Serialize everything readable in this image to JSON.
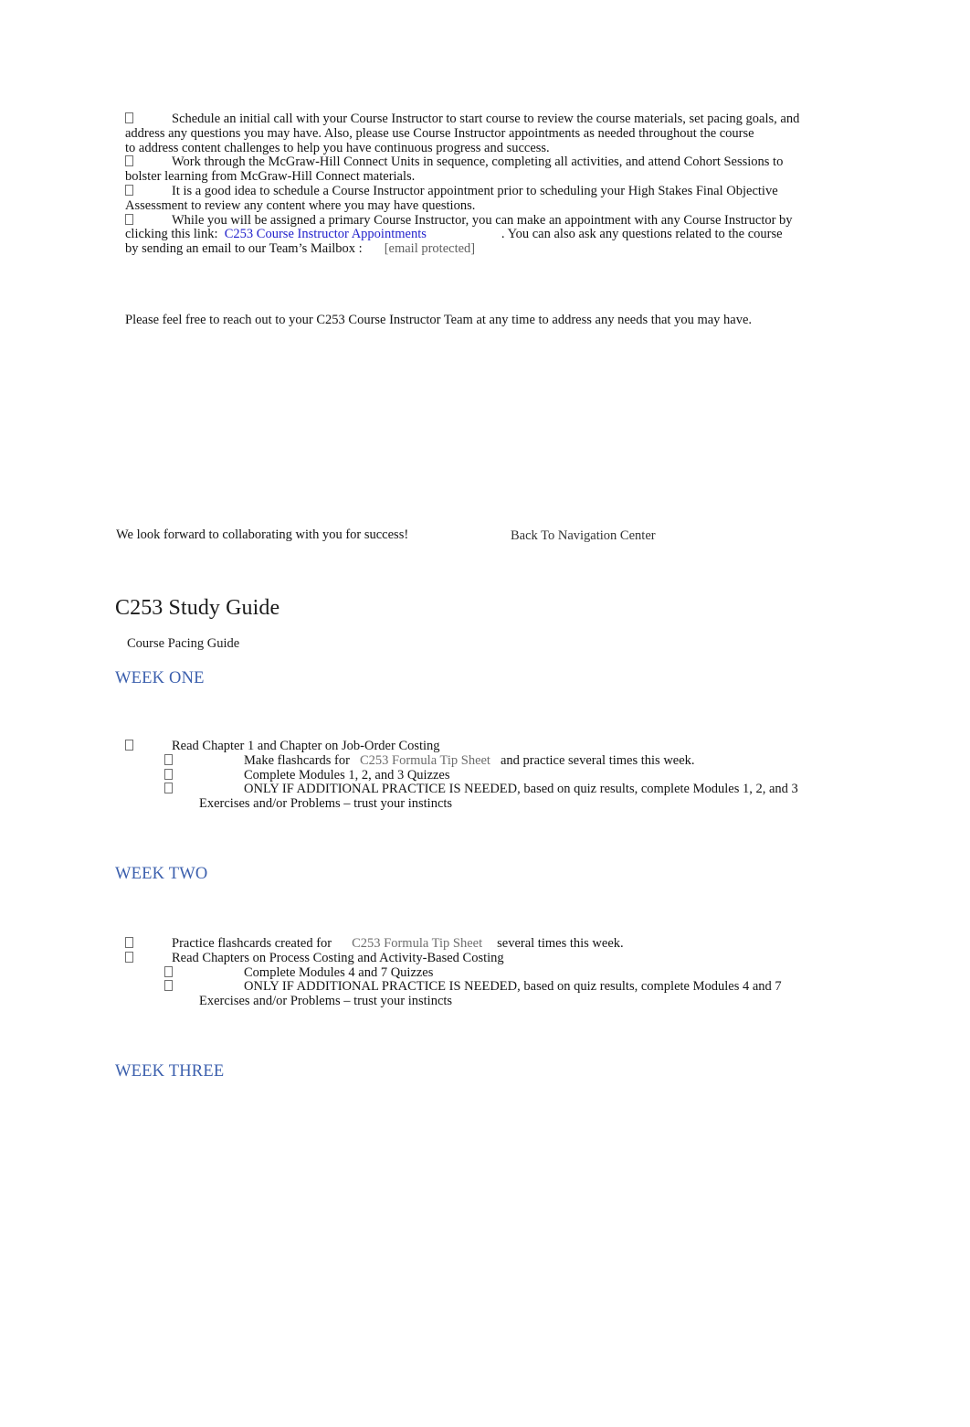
{
  "document": {
    "title": "C253 Study Guide"
  },
  "intro_bullets": [
    {
      "id": "bullet-initial-call",
      "lines": [
        "Schedule an initial call with your Course Instructor to start course to review the course materials, set pacing goals, and",
        "address any questions you may have. Also, please use Course Instructor appointments as needed throughout the course",
        "to address content challenges to help you have continuous progress and success."
      ]
    },
    {
      "id": "bullet-connect-units",
      "lines": [
        "Work through the McGraw-Hill Connect Units in sequence, completing all activities, and attend Cohort Sessions to",
        "bolster learning from McGraw-Hill Connect materials."
      ]
    },
    {
      "id": "bullet-appointment-before-oa",
      "lines": [
        "It is a good idea to schedule a Course Instructor appointment prior to scheduling your High Stakes Final Objective",
        "Assessment to review any content where you may have questions."
      ]
    }
  ],
  "bullet_appointments": {
    "line1": "While you will be assigned a primary Course Instructor, you can make an appointment with any Course Instructor by",
    "line2_prefix": "clicking this link:",
    "link_label": "C253 Course Instructor Appointments",
    "line2_suffix": ". You can also ask any questions related to the course",
    "line3_prefix": "by sending an email to our Team’s Mailbox :",
    "email_label": "[email protected]"
  },
  "closing": {
    "reach_out": "Please feel free to reach out to your C253 Course Instructor Team at any time to address any needs that you may have.",
    "look_forward": "We look forward to collaborating with you for success!",
    "back_to_nav": "Back To Navigation Center"
  },
  "study_guide": {
    "heading": "C253 Study Guide",
    "subheading": "Course Pacing Guide"
  },
  "weeks": [
    {
      "id": "week-one",
      "heading": "WEEK ONE",
      "items": [
        {
          "level": 1,
          "text": "Read Chapter 1 and Chapter on Job-Order Costing"
        },
        {
          "level": 2,
          "prefix": "Make flashcards for",
          "link": "C253 Formula Tip Sheet",
          "suffix": "and practice several times this week."
        },
        {
          "level": 2,
          "text": "Complete Modules 1, 2, and 3 Quizzes"
        },
        {
          "level": 2,
          "text": "ONLY IF ADDITIONAL PRACTICE IS NEEDED, based on quiz results, complete Modules 1, 2, and 3",
          "continuation": "Exercises and/or Problems – trust your instincts"
        }
      ]
    },
    {
      "id": "week-two",
      "heading": "WEEK TWO",
      "items": [
        {
          "level": 1,
          "prefix": "Practice flashcards created for",
          "link": "C253 Formula Tip Sheet",
          "suffix": "several times this week."
        },
        {
          "level": 1,
          "text": "Read Chapters on Process Costing and Activity-Based Costing"
        },
        {
          "level": 2,
          "text": "Complete Modules 4 and 7 Quizzes"
        },
        {
          "level": 2,
          "text": "ONLY IF ADDITIONAL PRACTICE IS NEEDED, based on quiz results, complete Modules 4 and 7",
          "continuation": "Exercises and/or Problems – trust your instincts"
        }
      ]
    },
    {
      "id": "week-three",
      "heading": "WEEK THREE",
      "items": []
    }
  ],
  "colors": {
    "link_blue": "#2222cc",
    "heading_blue": "#3b5fad",
    "body_text": "#131313",
    "gray_link": "#6d6d6d"
  }
}
